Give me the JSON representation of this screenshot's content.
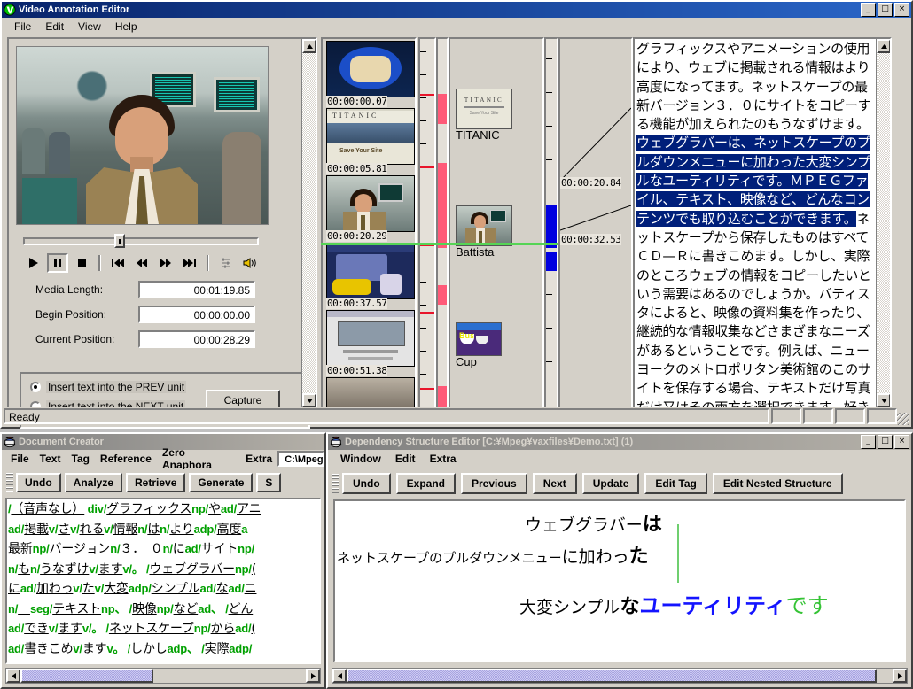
{
  "video_editor": {
    "title": "Video Annotation Editor",
    "menu": [
      "File",
      "Edit",
      "View",
      "Help"
    ],
    "window_buttons": [
      "_",
      "□",
      "×"
    ],
    "transport": {
      "play": "▶",
      "pause": "‖",
      "stop": "■",
      "prev_start": "|◀◀",
      "rewind": "◀◀",
      "forward": "▶▶",
      "next_end": "▶▶|",
      "settings": "settings",
      "volume": "volume"
    },
    "fields": [
      {
        "label": "Media Length:",
        "value": "00:01:19.85"
      },
      {
        "label": "Begin Position:",
        "value": "00:00:00.00"
      },
      {
        "label": "Current Position:",
        "value": "00:00:28.29"
      }
    ],
    "options": {
      "prev": "Insert text into the PREV unit",
      "next": "Insert text into the NEXT unit",
      "selected": "prev",
      "capture": "Capture"
    },
    "timeline_thumbnails": [
      {
        "timestamp": "00:00:00.07"
      },
      {
        "timestamp": "00:00:05.81"
      },
      {
        "timestamp": "00:00:20.29"
      },
      {
        "timestamp": "00:00:37.57"
      },
      {
        "timestamp": "00:00:51.38"
      }
    ],
    "keyframes": [
      {
        "label": "TITANIC"
      },
      {
        "label": "Battista"
      },
      {
        "label": "Cup"
      }
    ],
    "link_timestamps": [
      "00:00:20.84",
      "00:00:32.53"
    ],
    "transcript": {
      "before": "グラフィックスやアニメーションの使用により、ウェブに掲載される情報はより高度になってます。ネットスケープの最新バージョン３．０にサイトをコピーする機能が加えられたのもうなずけます。",
      "highlighted": "ウェブグラバーは、ネットスケープのプルダウンメニューに加わった大変シンプルなユーティリティです。ＭＰＥＧファイル、テキスト、映像など、どんなコンテンツでも取り込むことができます。",
      "after": "ネットスケープから保存したものはすべてＣＤ—Ｒに書きこめます。しかし、実際のところウェブの情報をコピーしたいという需要はあるのでしょうか。バティスタによると、映像の資料集を作ったり、継続的な情報収集などさまざまなニーズがあるということです。例えば、ニューヨークのメトロポリタン美術館のこのサイトを保存する場合、テキストだけ写真だけ又はその両方を選択できます。好きな写真をＣＤに保存することもできます。バティスタによると個人の"
    },
    "status": "Ready"
  },
  "document_creator": {
    "title": "Document Creator",
    "menu": [
      "File",
      "Text",
      "Tag",
      "Reference",
      "Zero Anaphora",
      "Extra"
    ],
    "path_field": "C:\\Mpeg¥",
    "toolbar": [
      "Undo",
      "Analyze",
      "Retrieve",
      "Generate",
      "S"
    ],
    "tagged_lines": [
      [
        {
          "t": "/",
          "k": "tag"
        },
        {
          "t": "（音声なし）",
          "k": "u"
        },
        {
          "t": " div/",
          "k": "tag"
        },
        {
          "t": "グラフィックス",
          "k": "u"
        },
        {
          "t": "np/",
          "k": "tag"
        },
        {
          "t": "や",
          "k": "u"
        },
        {
          "t": "ad/",
          "k": "tag"
        },
        {
          "t": "アニ",
          "k": "u"
        }
      ],
      [
        {
          "t": "ad/",
          "k": "tag"
        },
        {
          "t": "掲載",
          "k": "u"
        },
        {
          "t": "v/",
          "k": "tag"
        },
        {
          "t": "さ",
          "k": "u"
        },
        {
          "t": "v/",
          "k": "tag"
        },
        {
          "t": "れる",
          "k": "u"
        },
        {
          "t": "v/",
          "k": "tag"
        },
        {
          "t": "情報",
          "k": "u"
        },
        {
          "t": "n/",
          "k": "tag"
        },
        {
          "t": "は",
          "k": "u"
        },
        {
          "t": "n/",
          "k": "tag"
        },
        {
          "t": "より",
          "k": "u"
        },
        {
          "t": "adp/",
          "k": "tag"
        },
        {
          "t": "高度",
          "k": "u"
        },
        {
          "t": "a",
          "k": "tag"
        }
      ],
      [
        {
          "t": "最新",
          "k": "u"
        },
        {
          "t": "np/",
          "k": "tag"
        },
        {
          "t": "バージョン",
          "k": "u"
        },
        {
          "t": "n/",
          "k": "tag"
        },
        {
          "t": "３．　０",
          "k": "u"
        },
        {
          "t": "n/",
          "k": "tag"
        },
        {
          "t": "に",
          "k": "u"
        },
        {
          "t": "ad/",
          "k": "tag"
        },
        {
          "t": "サイト",
          "k": "u"
        },
        {
          "t": "np/",
          "k": "tag"
        }
      ],
      [
        {
          "t": "n/",
          "k": "tag"
        },
        {
          "t": "も",
          "k": "u"
        },
        {
          "t": "n/",
          "k": "tag"
        },
        {
          "t": "うなずけ",
          "k": "u"
        },
        {
          "t": "v/",
          "k": "tag"
        },
        {
          "t": "ます",
          "k": "u"
        },
        {
          "t": "v/",
          "k": "tag"
        },
        {
          "t": "。 /",
          "k": "tag"
        },
        {
          "t": "ウェブグラバー",
          "k": "u"
        },
        {
          "t": "np/",
          "k": "tag"
        },
        {
          "t": "(",
          "k": "u"
        }
      ],
      [
        {
          "t": "に",
          "k": "u"
        },
        {
          "t": "ad/",
          "k": "tag"
        },
        {
          "t": "加わっ",
          "k": "u"
        },
        {
          "t": "v/",
          "k": "tag"
        },
        {
          "t": "た",
          "k": "u"
        },
        {
          "t": "v/",
          "k": "tag"
        },
        {
          "t": "大変",
          "k": "u"
        },
        {
          "t": "adp/",
          "k": "tag"
        },
        {
          "t": "シンプル",
          "k": "u"
        },
        {
          "t": "ad/",
          "k": "tag"
        },
        {
          "t": "な",
          "k": "u"
        },
        {
          "t": "ad/",
          "k": "tag"
        },
        {
          "t": "ニ",
          "k": "u"
        }
      ],
      [
        {
          "t": "n/",
          "k": "tag"
        },
        {
          "t": "　",
          "k": "u"
        },
        {
          "t": "seg/",
          "k": "tag"
        },
        {
          "t": "テキスト",
          "k": "u"
        },
        {
          "t": "np",
          "k": "tag"
        },
        {
          "t": "、 /",
          "k": "tag"
        },
        {
          "t": "映像",
          "k": "u"
        },
        {
          "t": "np/",
          "k": "tag"
        },
        {
          "t": "など",
          "k": "u"
        },
        {
          "t": "ad",
          "k": "tag"
        },
        {
          "t": "、 /",
          "k": "tag"
        },
        {
          "t": "どん",
          "k": "u"
        }
      ],
      [
        {
          "t": "ad/",
          "k": "tag"
        },
        {
          "t": "でき",
          "k": "u"
        },
        {
          "t": "v/",
          "k": "tag"
        },
        {
          "t": "ます",
          "k": "u"
        },
        {
          "t": "v/",
          "k": "tag"
        },
        {
          "t": "。 /",
          "k": "tag"
        },
        {
          "t": "ネットスケープ",
          "k": "u"
        },
        {
          "t": "np/",
          "k": "tag"
        },
        {
          "t": "から",
          "k": "u"
        },
        {
          "t": "ad/",
          "k": "tag"
        },
        {
          "t": "(",
          "k": "u"
        }
      ],
      [
        {
          "t": "ad/",
          "k": "tag"
        },
        {
          "t": "書きこめ",
          "k": "u"
        },
        {
          "t": "v/",
          "k": "tag"
        },
        {
          "t": "ます",
          "k": "u"
        },
        {
          "t": "v。 /",
          "k": "tag"
        },
        {
          "t": "しかし",
          "k": "u"
        },
        {
          "t": "adp、 /",
          "k": "tag"
        },
        {
          "t": "実際",
          "k": "u"
        },
        {
          "t": "adp/",
          "k": "tag"
        }
      ]
    ]
  },
  "dependency_editor": {
    "title": "Dependency Structure Editor [C:¥Mpeg¥vaxfiles¥Demo.txt] (1)",
    "menu": [
      "Window",
      "Edit",
      "Extra"
    ],
    "window_buttons": [
      "_",
      "□",
      "×"
    ],
    "toolbar": [
      "Undo",
      "Expand",
      "Previous",
      "Next",
      "Update",
      "Edit Tag",
      "Edit Nested Structure"
    ],
    "tree": {
      "line1_body": "ウェブグラバー",
      "line1_particle": "は",
      "line2_body": "ネットスケープのプルダウンメニュー",
      "line2_mid": "に加わっ",
      "line2_particle": "た",
      "line3_body": "大変シンプル",
      "line3_particle": "な",
      "line3_head": "ユーティリティ",
      "line3_tail": "です"
    }
  }
}
